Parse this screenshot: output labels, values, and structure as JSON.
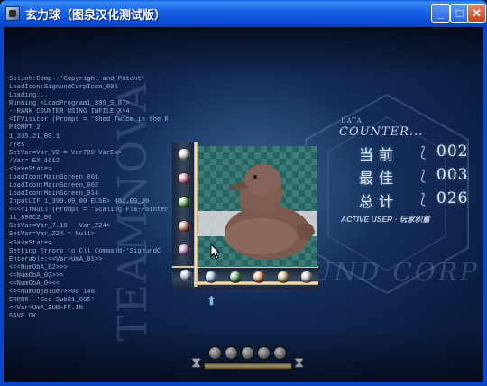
{
  "window": {
    "title": "玄力球（图泉汉化测试版）",
    "controls": {
      "minimize": "_",
      "maximize": "□",
      "close": "✕"
    }
  },
  "background": {
    "vertical_text": "TEAMNOVA",
    "corp_text": "UND CORP"
  },
  "log_lines": [
    "Splinh:Comp--'Copyright and Patent'",
    "LoadIcon:SignundCorpIcon_005",
    "Loading...",
    "Running <LoadProgram1_399_S_87>",
    "--RANK COUNTER USING INFILE X^4",
    "<IFVisitor (Prompt = 'Shed Twice in the Riv",
    "PROMPT 2",
    "  1_335.21_00.1",
    "  /Yes",
    "SetVar=Var_V2 = Var720~VarEx>",
    "  /Var=  EX 1612",
    "<SaveState>",
    "LoadIcon:MainScreen_001",
    "LoadIcon:MainScreen_002",
    "LoadIcon:MainScreen_014",
    "InputLIF 1_399.09_00 ELSE> 462.00_09",
    "<<<<IfNull (Prompt = 'Scaling Fla-Pointer' &",
    "  11_898C2_00",
    "SetVar=Var_7.10 ~ Var_Z24>",
    "SetVar=Var_Z24 = Null>",
    "<SaveState>",
    "Setting Errors to Cll_Command~'SignundC",
    "Enterable:<<Var>UmA_01>>",
    "  <<<NumObA_02>>>",
    "  <<NumObA_03>>>",
    "  <<NumObA_0<<<",
    "  <<<NumObjBlue?>>00 148",
    "ERROR--'See SubC1_0SC'",
    "  <<Var>UmA_SUB~FF.IN",
    "  SAVE OK"
  ],
  "game": {
    "left_rail_balls": [
      {
        "color": "#d8d8e0"
      },
      {
        "color": "#d06a8a"
      },
      {
        "color": "#5aa04a"
      },
      {
        "color": "#c07068"
      },
      {
        "color": "#9e6ab0"
      }
    ],
    "bottom_rail_balls": [
      {
        "color": "#8fb0d8"
      },
      {
        "color": "#5a9a5a"
      },
      {
        "color": "#d08a58"
      },
      {
        "color": "#c4a870"
      },
      {
        "color": "#b8b8c0"
      }
    ],
    "corner_ball": {
      "color": "#a8c0e0"
    },
    "pointer_symbol": "⬆"
  },
  "counter": {
    "data_label": "DATA",
    "heading": "COUNTER...",
    "rows": [
      {
        "label": "当前",
        "value": "002"
      },
      {
        "label": "最佳",
        "value": "003"
      },
      {
        "label": "总计",
        "value": "026"
      }
    ],
    "footer": "ACTIVE USER",
    "footer_suffix": "· 玩家积蓄"
  },
  "controls": {
    "hourglass_symbol": "⧗",
    "ball_count": 5
  }
}
